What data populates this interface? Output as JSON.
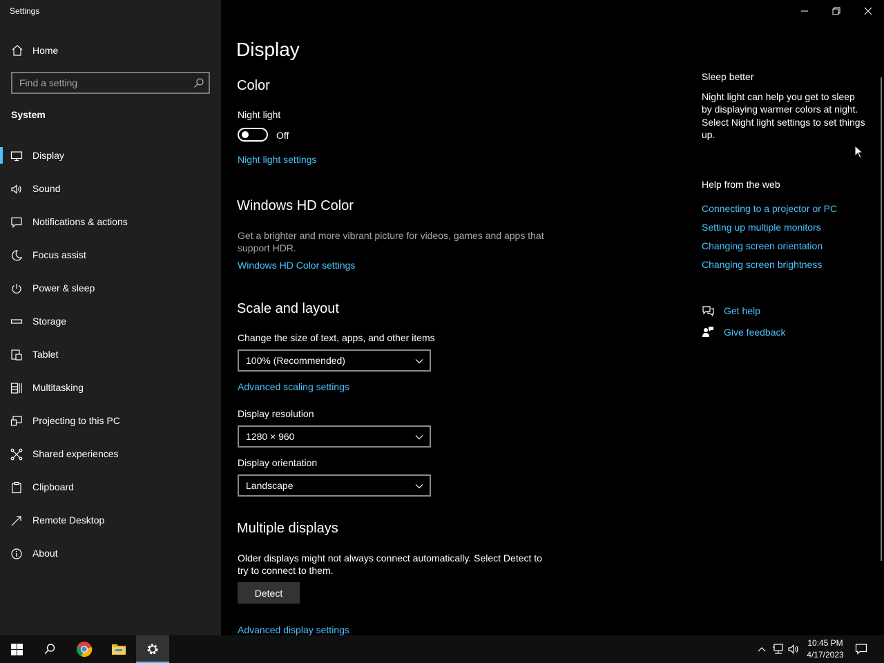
{
  "app": {
    "title": "Settings"
  },
  "sidebar": {
    "home_label": "Home",
    "search_placeholder": "Find a setting",
    "section_label": "System",
    "items": [
      {
        "label": "Display",
        "icon": "monitor-icon",
        "active": true
      },
      {
        "label": "Sound",
        "icon": "speaker-icon"
      },
      {
        "label": "Notifications & actions",
        "icon": "notification-icon"
      },
      {
        "label": "Focus assist",
        "icon": "moon-icon"
      },
      {
        "label": "Power & sleep",
        "icon": "power-icon"
      },
      {
        "label": "Storage",
        "icon": "storage-icon"
      },
      {
        "label": "Tablet",
        "icon": "tablet-icon"
      },
      {
        "label": "Multitasking",
        "icon": "multitasking-icon"
      },
      {
        "label": "Projecting to this PC",
        "icon": "projecting-icon"
      },
      {
        "label": "Shared experiences",
        "icon": "shared-icon"
      },
      {
        "label": "Clipboard",
        "icon": "clipboard-icon"
      },
      {
        "label": "Remote Desktop",
        "icon": "remote-desktop-icon"
      },
      {
        "label": "About",
        "icon": "info-icon"
      }
    ]
  },
  "main": {
    "title": "Display",
    "color": {
      "heading": "Color",
      "night_light_label": "Night light",
      "toggle_state": "Off",
      "night_light_settings_link": "Night light settings"
    },
    "hdr": {
      "heading": "Windows HD Color",
      "description_1": "Get a brighter and more vibrant picture for videos, games and apps that",
      "description_2": "support HDR.",
      "link": "Windows HD Color settings"
    },
    "scale": {
      "heading": "Scale and layout",
      "size_label": "Change the size of text, apps, and other items",
      "size_value": "100% (Recommended)",
      "advanced_scaling_link": "Advanced scaling settings",
      "resolution_label": "Display resolution",
      "resolution_value": "1280 × 960",
      "orientation_label": "Display orientation",
      "orientation_value": "Landscape"
    },
    "multiple": {
      "heading": "Multiple displays",
      "description_1": "Older displays might not always connect automatically. Select Detect to",
      "description_2": "try to connect to them.",
      "detect_button": "Detect",
      "advanced_display_link": "Advanced display settings"
    }
  },
  "right_panel": {
    "sleep_heading": "Sleep better",
    "sleep_text": [
      "Night light can help you get to sleep",
      "by displaying warmer colors at night.",
      "Select Night light settings to set things",
      "up."
    ],
    "help_heading": "Help from the web",
    "help_links": [
      "Connecting to a projector or PC",
      "Setting up multiple monitors",
      "Changing screen orientation",
      "Changing screen brightness"
    ],
    "get_help": "Get help",
    "give_feedback": "Give feedback"
  },
  "taskbar": {
    "time": "10:45 PM",
    "date": "4/17/2023"
  },
  "colors": {
    "accent": "#4cc2ff",
    "sidebar_bg": "#1f1f1f",
    "main_bg": "#000000"
  }
}
